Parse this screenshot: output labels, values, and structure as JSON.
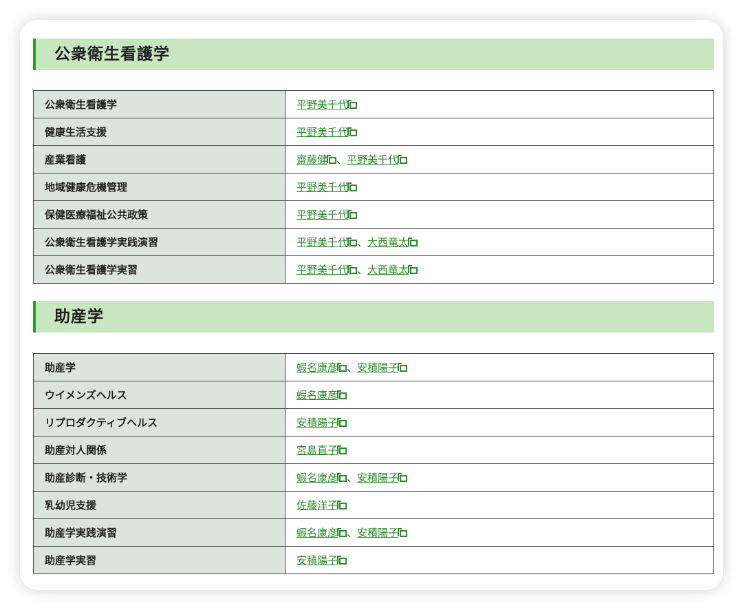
{
  "sections": [
    {
      "title": "公衆衛生看護学",
      "rows": [
        {
          "subject": "公衆衛生看護学",
          "staff": [
            "平野美千代"
          ]
        },
        {
          "subject": "健康生活支援",
          "staff": [
            "平野美千代"
          ]
        },
        {
          "subject": "産業看護",
          "staff": [
            "齋藤健",
            "平野美千代"
          ]
        },
        {
          "subject": "地域健康危機管理",
          "staff": [
            "平野美千代"
          ]
        },
        {
          "subject": "保健医療福祉公共政策",
          "staff": [
            "平野美千代"
          ]
        },
        {
          "subject": "公衆衛生看護学実践演習",
          "staff": [
            "平野美千代",
            "大西竜太"
          ]
        },
        {
          "subject": "公衆衛生看護学実習",
          "staff": [
            "平野美千代",
            "大西竜太"
          ]
        }
      ]
    },
    {
      "title": "助産学",
      "rows": [
        {
          "subject": "助産学",
          "staff": [
            "蝦名康彦",
            "安積陽子"
          ]
        },
        {
          "subject": "ウイメンズヘルス",
          "staff": [
            "蝦名康彦"
          ]
        },
        {
          "subject": "リプロダクティブヘルス",
          "staff": [
            "安積陽子"
          ]
        },
        {
          "subject": "助産対人関係",
          "staff": [
            "宮島直子"
          ]
        },
        {
          "subject": "助産診断・技術学",
          "staff": [
            "蝦名康彦",
            "安積陽子"
          ]
        },
        {
          "subject": "乳幼児支援",
          "staff": [
            "佐藤洋子"
          ]
        },
        {
          "subject": "助産学実践演習",
          "staff": [
            "蝦名康彦",
            "安積陽子"
          ]
        },
        {
          "subject": "助産学実習",
          "staff": [
            "安積陽子"
          ]
        }
      ]
    }
  ],
  "separator": "、",
  "icons": {
    "external_link": "external-link-icon"
  },
  "colors": {
    "heading_bg": "#c8e6c0",
    "heading_accent": "#2e9a2e",
    "link": "#2a8a2a",
    "subject_bg": "#dde3dd"
  }
}
